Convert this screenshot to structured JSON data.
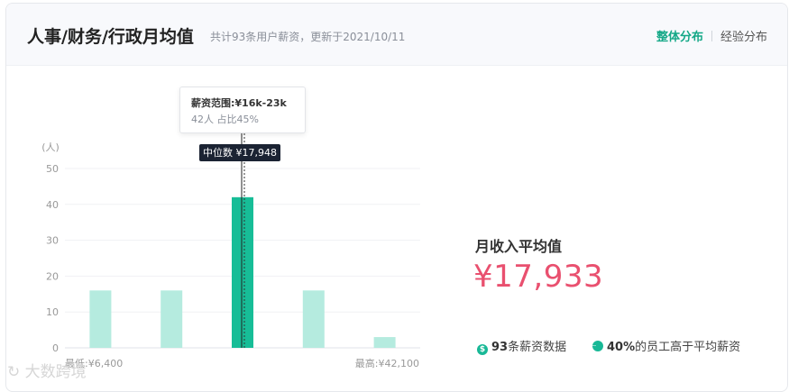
{
  "header": {
    "title": "人事/财务/行政月均值",
    "subtitle": "共计93条用户薪资，更新于2021/10/11",
    "tabs": [
      {
        "label": "整体分布",
        "active": true
      },
      {
        "label": "经验分布",
        "active": false
      }
    ]
  },
  "tooltip": {
    "range": "薪资范围:¥16k-23k",
    "detail": "42人  占比45%"
  },
  "median_tag": "中位数 ¥17,948",
  "summary": {
    "avg_label": "月收入平均值",
    "avg_value": "¥17,933",
    "stat1_strong": "93",
    "stat1_text": "条薪资数据",
    "stat2_strong": "40%",
    "stat2_text": "的员工高于平均薪资"
  },
  "watermark": "大数跨境",
  "colors": {
    "accent": "#14a887",
    "bar_highlight": "#17bd97",
    "bar_normal": "#b5ebdf",
    "avg_value": "#e9506f",
    "tag_bg": "#1b2333"
  },
  "icons": [
    "dollar-circle-icon",
    "pie-chart-icon"
  ],
  "chart_data": {
    "type": "bar",
    "ylabel": "(人)",
    "ylim": [
      0,
      50
    ],
    "yticks": [
      "0",
      "10",
      "20",
      "30",
      "40",
      "50"
    ],
    "categories": [
      "1",
      "2",
      "3",
      "4",
      "5"
    ],
    "values": [
      16,
      16,
      42,
      16,
      3
    ],
    "highlight_index": 2,
    "min_label": "最低:¥6,400",
    "max_label": "最高:¥42,100",
    "grid": true,
    "legend": "none"
  }
}
